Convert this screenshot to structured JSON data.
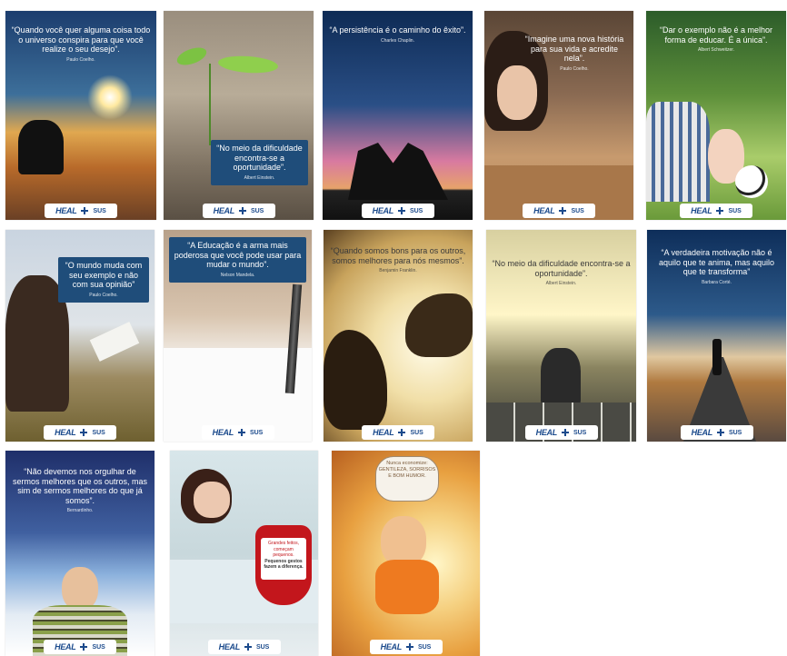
{
  "footer": {
    "brand": "HEAL",
    "partner": "SUS"
  },
  "posters": [
    {
      "quote": "“Quando você quer alguma coisa todo o universo conspira para que você realize o seu desejo”.",
      "author": "Paulo Coelho."
    },
    {
      "quote": "“No meio da dificuldade encontra-se a oportunidade”.",
      "author": "Albert Einstein."
    },
    {
      "quote": "“A persistência é o caminho do êxito”.",
      "author": "Charles Chaplin."
    },
    {
      "quote": "“Imagine uma nova história para sua vida e acredite nela”.",
      "author": "Paulo Coelho."
    },
    {
      "quote": "“Dar o exemplo não é a melhor forma de educar. É a única”.",
      "author": "Albert Schweitzer."
    },
    {
      "quote": "“O mundo muda com seu exemplo e não com sua opinião”",
      "author": "Paulo Coelho."
    },
    {
      "quote": "“A Educação é a arma mais poderosa que você pode usar para mudar o mundo”.",
      "author": "Nelson Mandela."
    },
    {
      "quote": "“Quando somos bons para os outros, somos melhores para nós mesmos”.",
      "author": "Benjamin Franklin."
    },
    {
      "quote": "“No meio da dificuldade encontra-se a oportunidade”.",
      "author": "Albert Einstein."
    },
    {
      "quote": "“A verdadeira motivação não é aquilo que te anima, mas aquilo que te transforma”",
      "author": "Barbara Corté."
    },
    {
      "quote": "“Não devemos nos orgulhar de sermos melhores que os outros, mas sim de sermos melhores do que já somos”.",
      "author": "Bernardinho."
    },
    {
      "quote": "Pequenos gestos fazem a diferença.",
      "author": "Grandes feitos, começam pequenos."
    },
    {
      "quote": "Nunca economize: GENTILEZA, SORRISOS E BOM HUMOR.",
      "author": ""
    }
  ]
}
